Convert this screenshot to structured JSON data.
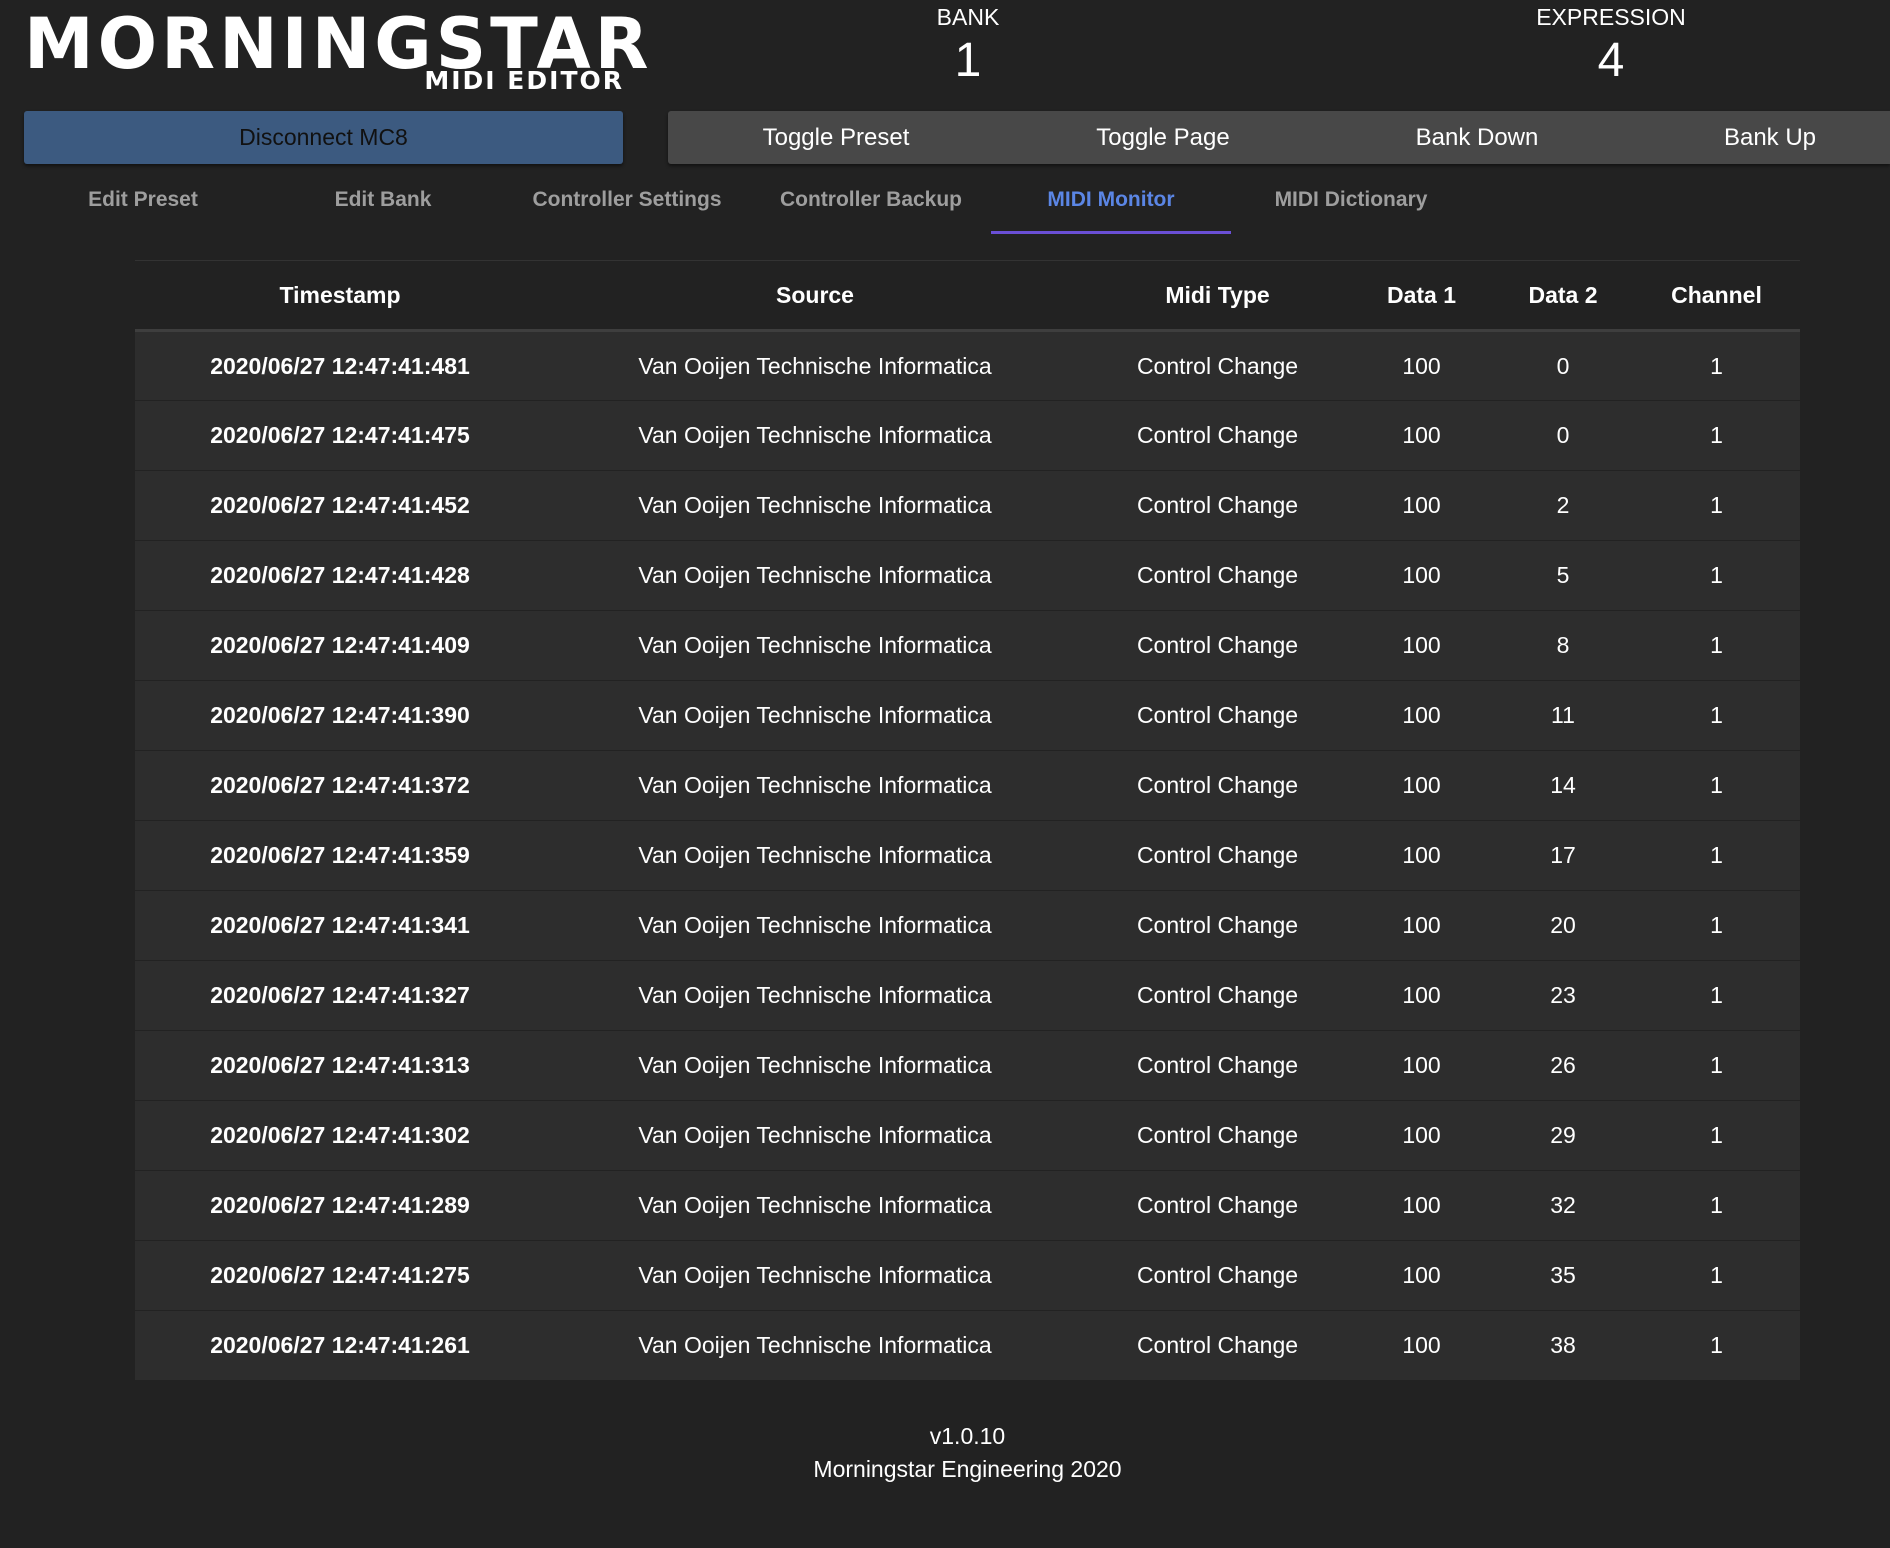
{
  "logo": {
    "main": "MORNINGSTAR",
    "sub": "MIDI EDITOR"
  },
  "status": {
    "bank_label": "BANK",
    "bank_value": "1",
    "expression_label": "EXPRESSION",
    "expression_value": "4"
  },
  "buttons": {
    "disconnect": "Disconnect MC8",
    "toggle_preset": "Toggle Preset",
    "toggle_page": "Toggle Page",
    "bank_down": "Bank Down",
    "bank_up": "Bank Up"
  },
  "tabs": [
    {
      "label": "Edit Preset"
    },
    {
      "label": "Edit Bank"
    },
    {
      "label": "Controller Settings"
    },
    {
      "label": "Controller Backup"
    },
    {
      "label": "MIDI Monitor",
      "active": true
    },
    {
      "label": "MIDI Dictionary"
    }
  ],
  "table": {
    "headers": [
      "Timestamp",
      "Source",
      "Midi Type",
      "Data 1",
      "Data 2",
      "Channel"
    ],
    "rows": [
      [
        "2020/06/27 12:47:41:481",
        "Van Ooijen Technische Informatica",
        "Control Change",
        "100",
        "0",
        "1"
      ],
      [
        "2020/06/27 12:47:41:475",
        "Van Ooijen Technische Informatica",
        "Control Change",
        "100",
        "0",
        "1"
      ],
      [
        "2020/06/27 12:47:41:452",
        "Van Ooijen Technische Informatica",
        "Control Change",
        "100",
        "2",
        "1"
      ],
      [
        "2020/06/27 12:47:41:428",
        "Van Ooijen Technische Informatica",
        "Control Change",
        "100",
        "5",
        "1"
      ],
      [
        "2020/06/27 12:47:41:409",
        "Van Ooijen Technische Informatica",
        "Control Change",
        "100",
        "8",
        "1"
      ],
      [
        "2020/06/27 12:47:41:390",
        "Van Ooijen Technische Informatica",
        "Control Change",
        "100",
        "11",
        "1"
      ],
      [
        "2020/06/27 12:47:41:372",
        "Van Ooijen Technische Informatica",
        "Control Change",
        "100",
        "14",
        "1"
      ],
      [
        "2020/06/27 12:47:41:359",
        "Van Ooijen Technische Informatica",
        "Control Change",
        "100",
        "17",
        "1"
      ],
      [
        "2020/06/27 12:47:41:341",
        "Van Ooijen Technische Informatica",
        "Control Change",
        "100",
        "20",
        "1"
      ],
      [
        "2020/06/27 12:47:41:327",
        "Van Ooijen Technische Informatica",
        "Control Change",
        "100",
        "23",
        "1"
      ],
      [
        "2020/06/27 12:47:41:313",
        "Van Ooijen Technische Informatica",
        "Control Change",
        "100",
        "26",
        "1"
      ],
      [
        "2020/06/27 12:47:41:302",
        "Van Ooijen Technische Informatica",
        "Control Change",
        "100",
        "29",
        "1"
      ],
      [
        "2020/06/27 12:47:41:289",
        "Van Ooijen Technische Informatica",
        "Control Change",
        "100",
        "32",
        "1"
      ],
      [
        "2020/06/27 12:47:41:275",
        "Van Ooijen Technische Informatica",
        "Control Change",
        "100",
        "35",
        "1"
      ],
      [
        "2020/06/27 12:47:41:261",
        "Van Ooijen Technische Informatica",
        "Control Change",
        "100",
        "38",
        "1"
      ]
    ]
  },
  "footer": {
    "version": "v1.0.10",
    "copyright": "Morningstar Engineering 2020"
  },
  "colors": {
    "background": "#222222",
    "disconnect_button": "#3c5a80",
    "control_bar": "#484848",
    "active_tab_text": "#5b86e5",
    "active_tab_underline": "#6a4fd6",
    "row_background": "#2d2d2d"
  }
}
